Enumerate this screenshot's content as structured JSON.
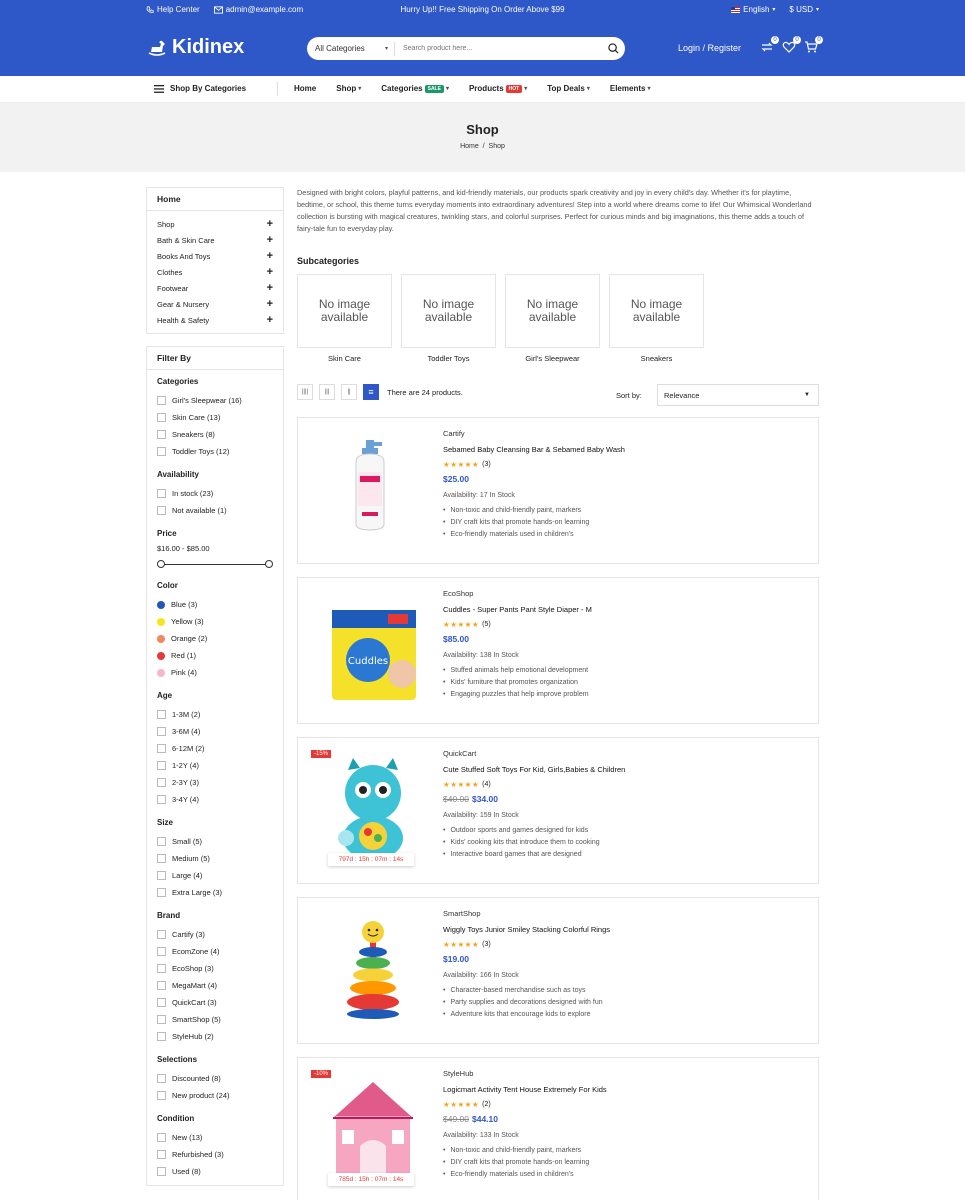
{
  "topbar": {
    "help": "Help Center",
    "email": "admin@example.com",
    "promo": "Hurry Up!! Free Shipping On Order Above $99",
    "language": "English",
    "currency": "$ USD"
  },
  "header": {
    "logo": "Kidinex",
    "search_category": "All Categories",
    "search_placeholder": "Search product here...",
    "login": "Login / Register",
    "compare_count": "0",
    "wishlist_count": "0",
    "cart_count": "0"
  },
  "nav": {
    "shop_by": "Shop By Categories",
    "items": [
      {
        "label": "Home",
        "tag": "",
        "caret": false
      },
      {
        "label": "Shop",
        "tag": "",
        "caret": true
      },
      {
        "label": "Categories",
        "tag": "SALE",
        "tag_color": "#1a9a6a",
        "caret": true
      },
      {
        "label": "Products",
        "tag": "HOT",
        "tag_color": "#e53935",
        "caret": true
      },
      {
        "label": "Top Deals",
        "tag": "",
        "caret": true
      },
      {
        "label": "Elements",
        "tag": "",
        "caret": true
      }
    ]
  },
  "page": {
    "title": "Shop",
    "breadcrumb": [
      "Home",
      "Shop"
    ],
    "description": "Designed with bright colors, playful patterns, and kid-friendly materials, our products spark creativity and joy in every child's day. Whether it's for playtime, bedtime, or school, this theme turns everyday moments into extraordinary adventures! Step into a world where dreams come to life! Our Whimsical Wonderland collection is bursting with magical creatures, twinkling stars, and colorful surprises. Perfect for curious minds and big imaginations, this theme adds a touch of fairy-tale fun to everyday play.",
    "subcategories_title": "Subcategories",
    "no_image": "No image available",
    "subcategories": [
      "Skin Care",
      "Toddler Toys",
      "Girl's Sleepwear",
      "Sneakers"
    ]
  },
  "sidebar": {
    "home": "Home",
    "categories": [
      "Shop",
      "Bath & Skin Care",
      "Books And Toys",
      "Clothes",
      "Footwear",
      "Gear & Nursery",
      "Health & Safety"
    ],
    "filter_by": "Filter By",
    "groups": {
      "categories": {
        "title": "Categories",
        "items": [
          "Girl's Sleepwear (16)",
          "Skin Care (13)",
          "Sneakers (8)",
          "Toddler Toys (12)"
        ]
      },
      "availability": {
        "title": "Availability",
        "items": [
          "In stock (23)",
          "Not available (1)"
        ]
      },
      "price": {
        "title": "Price",
        "range": "$16.00 - $85.00"
      },
      "color": {
        "title": "Color",
        "items": [
          {
            "label": "Blue (3)",
            "color": "#1e5bb8"
          },
          {
            "label": "Yellow (3)",
            "color": "#f5e61a"
          },
          {
            "label": "Orange (2)",
            "color": "#f08a5d"
          },
          {
            "label": "Red (1)",
            "color": "#e53935"
          },
          {
            "label": "Pink (4)",
            "color": "#f7b6c8"
          }
        ]
      },
      "age": {
        "title": "Age",
        "items": [
          "1-3M (2)",
          "3-6M (4)",
          "6-12M (2)",
          "1-2Y (4)",
          "2-3Y (3)",
          "3-4Y (4)"
        ]
      },
      "size": {
        "title": "Size",
        "items": [
          "Small (5)",
          "Medium (5)",
          "Large (4)",
          "Extra Large (3)"
        ]
      },
      "brand": {
        "title": "Brand",
        "items": [
          "Cartify (3)",
          "EcomZone (4)",
          "EcoShop (3)",
          "MegaMart (4)",
          "QuickCart (3)",
          "SmartShop (5)",
          "StyleHub (2)"
        ]
      },
      "selections": {
        "title": "Selections",
        "items": [
          "Discounted (8)",
          "New product (24)"
        ]
      },
      "condition": {
        "title": "Condition",
        "items": [
          "New (13)",
          "Refurbished (3)",
          "Used (8)"
        ]
      }
    }
  },
  "toolbar": {
    "count": "There are 24 products.",
    "sort_label": "Sort by:",
    "sort_value": "Relevance"
  },
  "products": [
    {
      "brand": "Cartify",
      "name": "Sebamed Baby Cleansing Bar & Sebamed Baby Wash",
      "rating": "(3)",
      "old_price": "",
      "price": "$25.00",
      "availability": "Availability: 17 In Stock",
      "discount": "",
      "timer": "",
      "features": [
        "Non-toxic and child-friendly paint, markers",
        "DIY craft kits that promote hands-on learning",
        "Eco-friendly materials used in children's"
      ],
      "image": "bottle"
    },
    {
      "brand": "EcoShop",
      "name": "Cuddles - Super Pants Pant Style Diaper - M",
      "rating": "(5)",
      "old_price": "",
      "price": "$85.00",
      "availability": "Availability: 138 In Stock",
      "discount": "",
      "timer": "",
      "features": [
        "Stuffed animals help emotional development",
        "Kids' furniture that promotes organization",
        "Engaging puzzles that help improve problem"
      ],
      "image": "diaper"
    },
    {
      "brand": "QuickCart",
      "name": "Cute Stuffed Soft Toys For Kid, Girls,Babies & Children",
      "rating": "(4)",
      "old_price": "$40.00",
      "price": "$34.00",
      "availability": "Availability: 159 In Stock",
      "discount": "-15%",
      "timer": "797d : 15h : 07m : 14s",
      "features": [
        "Outdoor sports and games designed for kids",
        "Kids' cooking kits that introduce them to cooking",
        "Interactive board games that are designed"
      ],
      "image": "toy"
    },
    {
      "brand": "SmartShop",
      "name": "Wiggly Toys Junior Smiley Stacking Colorful Rings",
      "rating": "(3)",
      "old_price": "",
      "price": "$19.00",
      "availability": "Availability: 166 In Stock",
      "discount": "",
      "timer": "",
      "features": [
        "Character-based merchandise such as toys",
        "Party supplies and decorations designed with fun",
        "Adventure kits that encourage kids to explore"
      ],
      "image": "rings"
    },
    {
      "brand": "StyleHub",
      "name": "Logicmart Activity Tent House Extremely For Kids",
      "rating": "(2)",
      "old_price": "$49.00",
      "price": "$44.10",
      "availability": "Availability: 133 In Stock",
      "discount": "-10%",
      "timer": "785d : 15h : 07m : 14s",
      "features": [
        "Non-toxic and child-friendly paint, markers",
        "DIY craft kits that promote hands-on learning",
        "Eco-friendly materials used in children's"
      ],
      "image": "tent"
    }
  ]
}
